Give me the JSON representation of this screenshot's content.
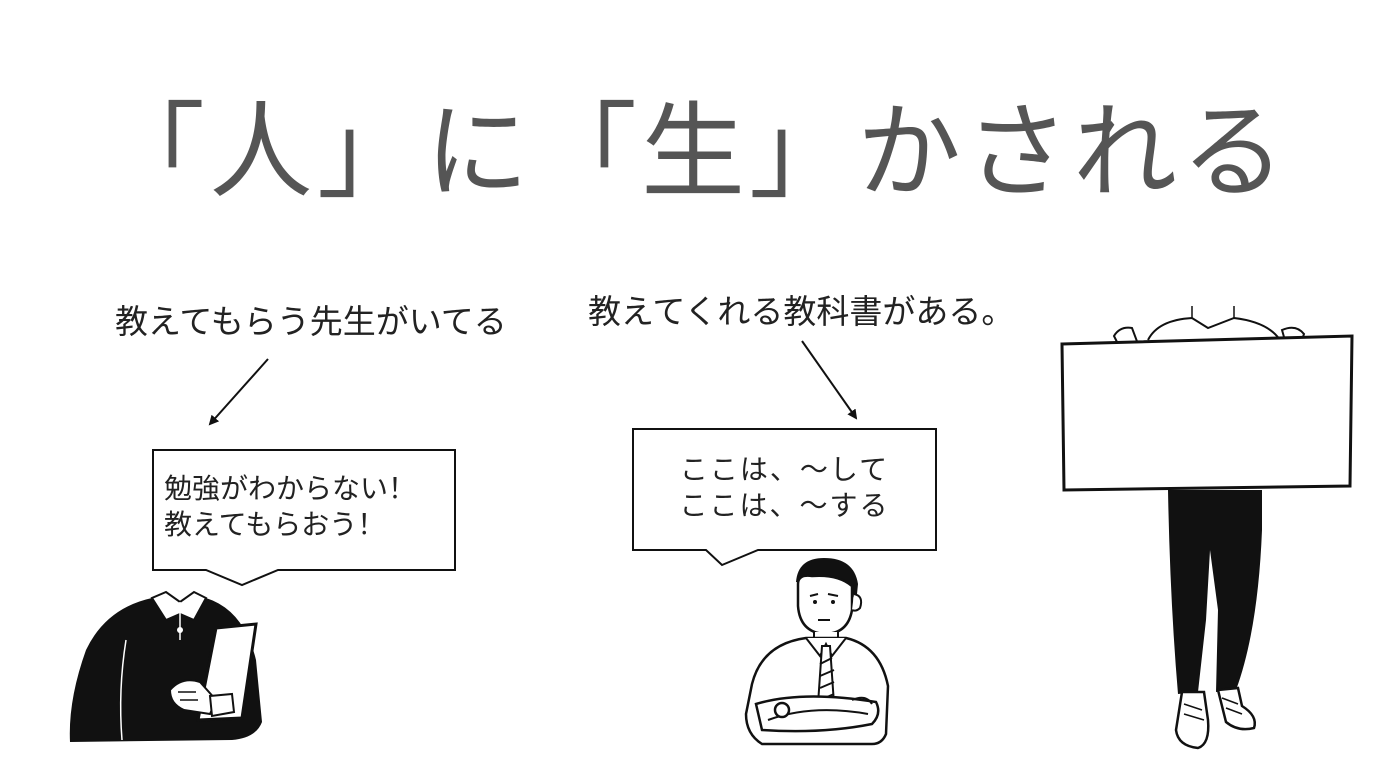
{
  "slide": {
    "title": "「人」に「生」かされる",
    "left": {
      "caption": "教えてもらう先生がいてる",
      "bubble_line1": "勉強がわからない！",
      "bubble_line2": "教えてもらおう！"
    },
    "center": {
      "caption": "教えてくれる教科書がある。",
      "bubble_line1": "ここは、～して",
      "bubble_line2": "ここは、～する"
    }
  },
  "icons": {
    "left_person": "student-holding-tablet-icon",
    "center_person": "man-arms-crossed-icon",
    "right_person": "person-holding-blank-sign-icon"
  }
}
